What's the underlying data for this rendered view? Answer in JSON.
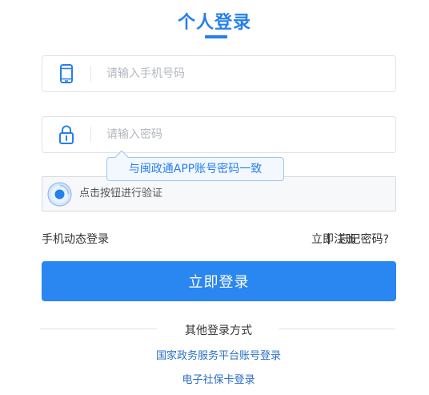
{
  "header": {
    "title": "个人登录"
  },
  "phone_field": {
    "placeholder": "请输入手机号码",
    "icon": "phone-icon"
  },
  "password_field": {
    "placeholder": "请输入密码",
    "icon": "lock-icon"
  },
  "tooltip": {
    "text": "与闽政通APP账号密码一致"
  },
  "verify": {
    "label": "点击按钮进行验证"
  },
  "links": {
    "sms_login": "手机动态登录",
    "register": "立即注册",
    "forgot": "忘记密码?"
  },
  "login_button": {
    "label": "立即登录"
  },
  "other_methods": {
    "title": "其他登录方式",
    "options": [
      "国家政务服务平台账号登录",
      "电子社保卡登录"
    ]
  },
  "colors": {
    "accent": "#2680eb",
    "button": "#2a86f0",
    "link": "#2b6fc6"
  }
}
